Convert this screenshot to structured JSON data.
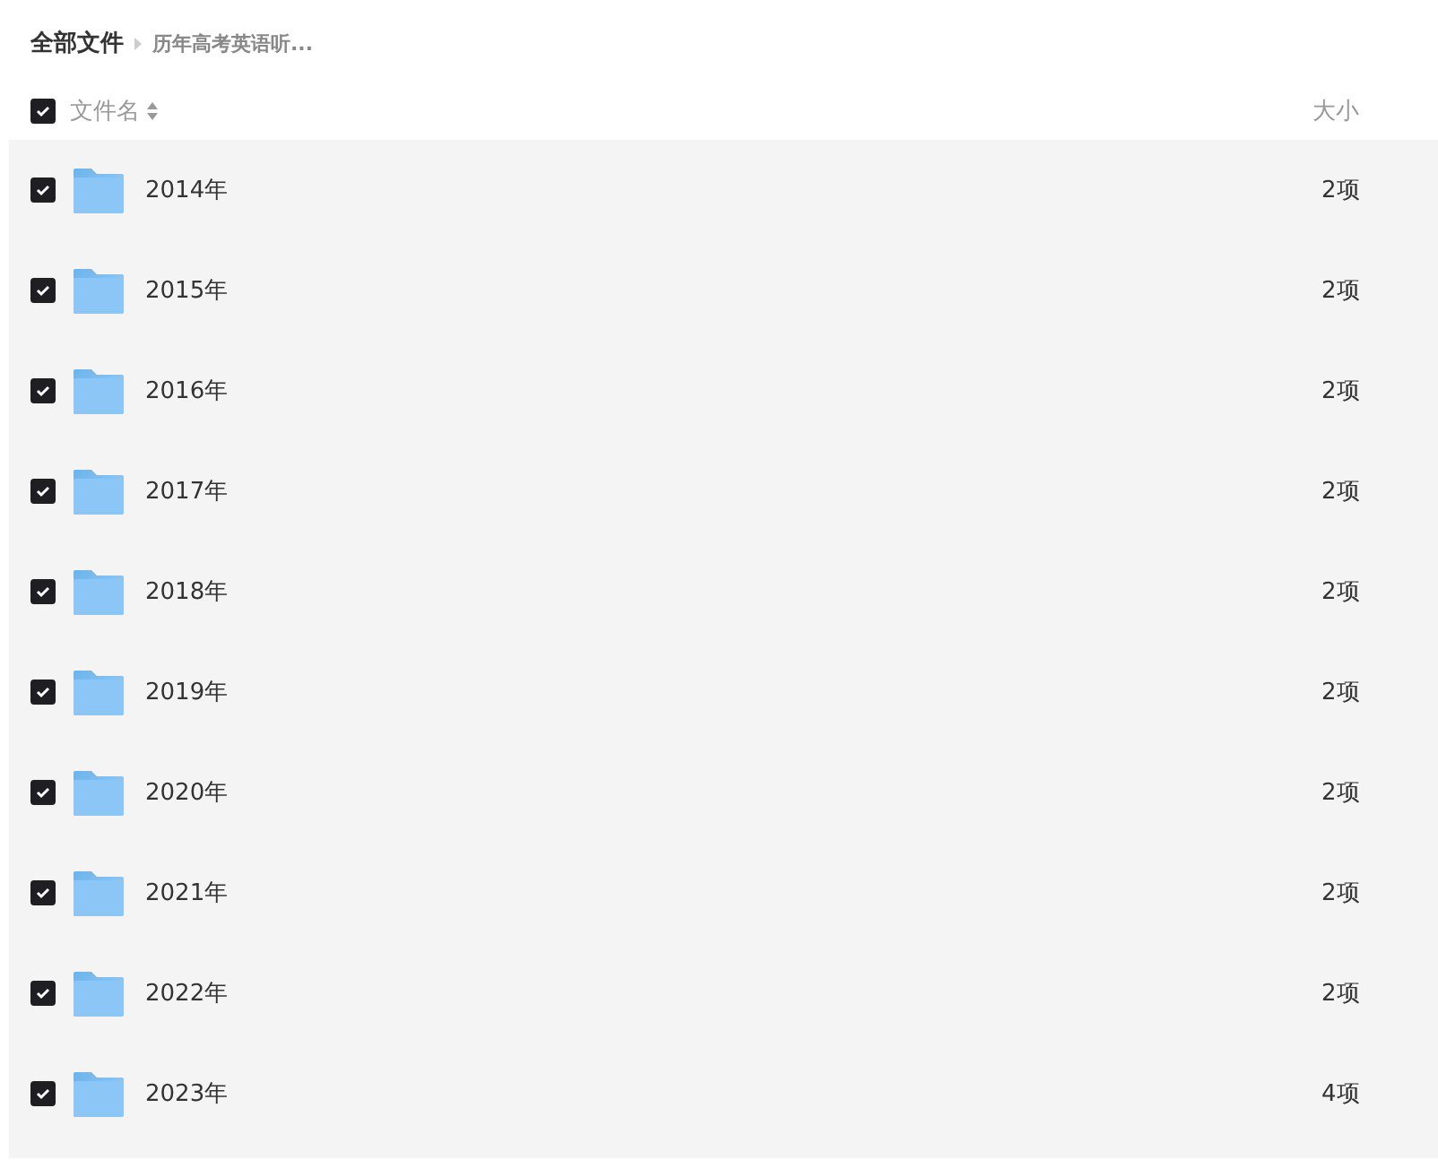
{
  "breadcrumb": [
    {
      "label": "全部文件",
      "current": false
    },
    {
      "label": "历年高考英语听...",
      "current": true
    }
  ],
  "header": {
    "checked": true,
    "name_label": "文件名",
    "size_label": "大小"
  },
  "rows": [
    {
      "name": "2014年",
      "size": "2项",
      "checked": true
    },
    {
      "name": "2015年",
      "size": "2项",
      "checked": true
    },
    {
      "name": "2016年",
      "size": "2项",
      "checked": true
    },
    {
      "name": "2017年",
      "size": "2项",
      "checked": true
    },
    {
      "name": "2018年",
      "size": "2项",
      "checked": true
    },
    {
      "name": "2019年",
      "size": "2项",
      "checked": true
    },
    {
      "name": "2020年",
      "size": "2项",
      "checked": true
    },
    {
      "name": "2021年",
      "size": "2项",
      "checked": true
    },
    {
      "name": "2022年",
      "size": "2项",
      "checked": true
    },
    {
      "name": "2023年",
      "size": "4项",
      "checked": true
    }
  ]
}
